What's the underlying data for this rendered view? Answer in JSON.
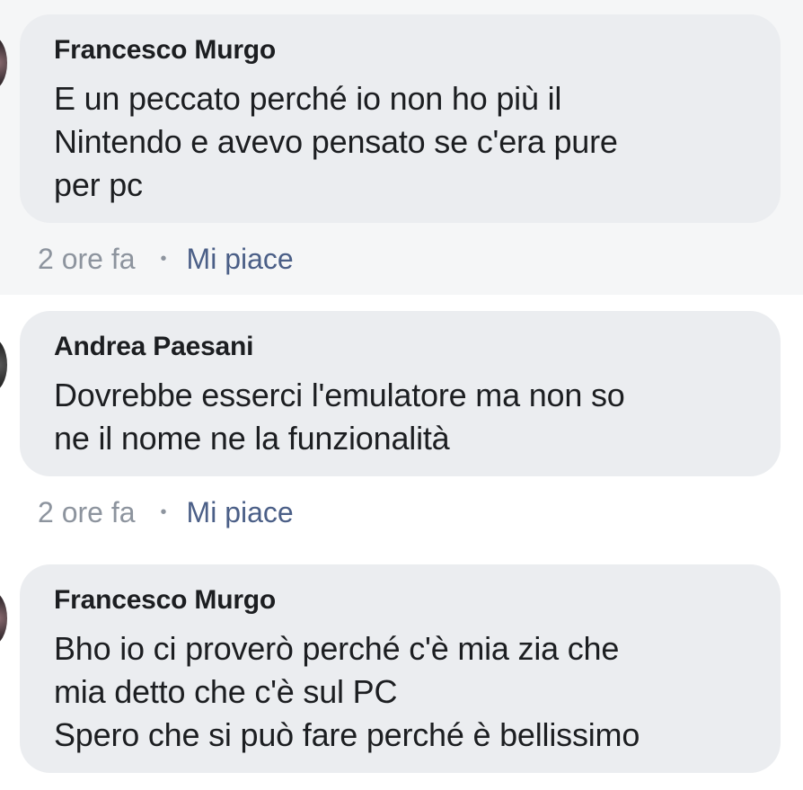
{
  "comments": [
    {
      "author": "Francesco Murgo",
      "text": "E un peccato perché io non ho più il\nNintendo e avevo pensato se c'era pure\nper pc",
      "time": "2 ore fa",
      "separator": "•",
      "like_label": "Mi piace"
    },
    {
      "author": "Andrea Paesani",
      "text": "Dovrebbe esserci l'emulatore ma non so\nne il nome ne la funzionalità",
      "time": "2 ore fa",
      "separator": "•",
      "like_label": "Mi piace"
    },
    {
      "author": "Francesco Murgo",
      "text": "Bho io ci proverò perché c'è mia zia che\nmia detto che c'è sul PC\nSpero che si può fare perché è bellissimo"
    }
  ],
  "colors": {
    "bubble_bg": "#ebedf0",
    "highlight_bg": "#f5f6f7",
    "text": "#1c1e21",
    "meta_gray": "#8d949e",
    "like_link": "#4b5f87"
  }
}
